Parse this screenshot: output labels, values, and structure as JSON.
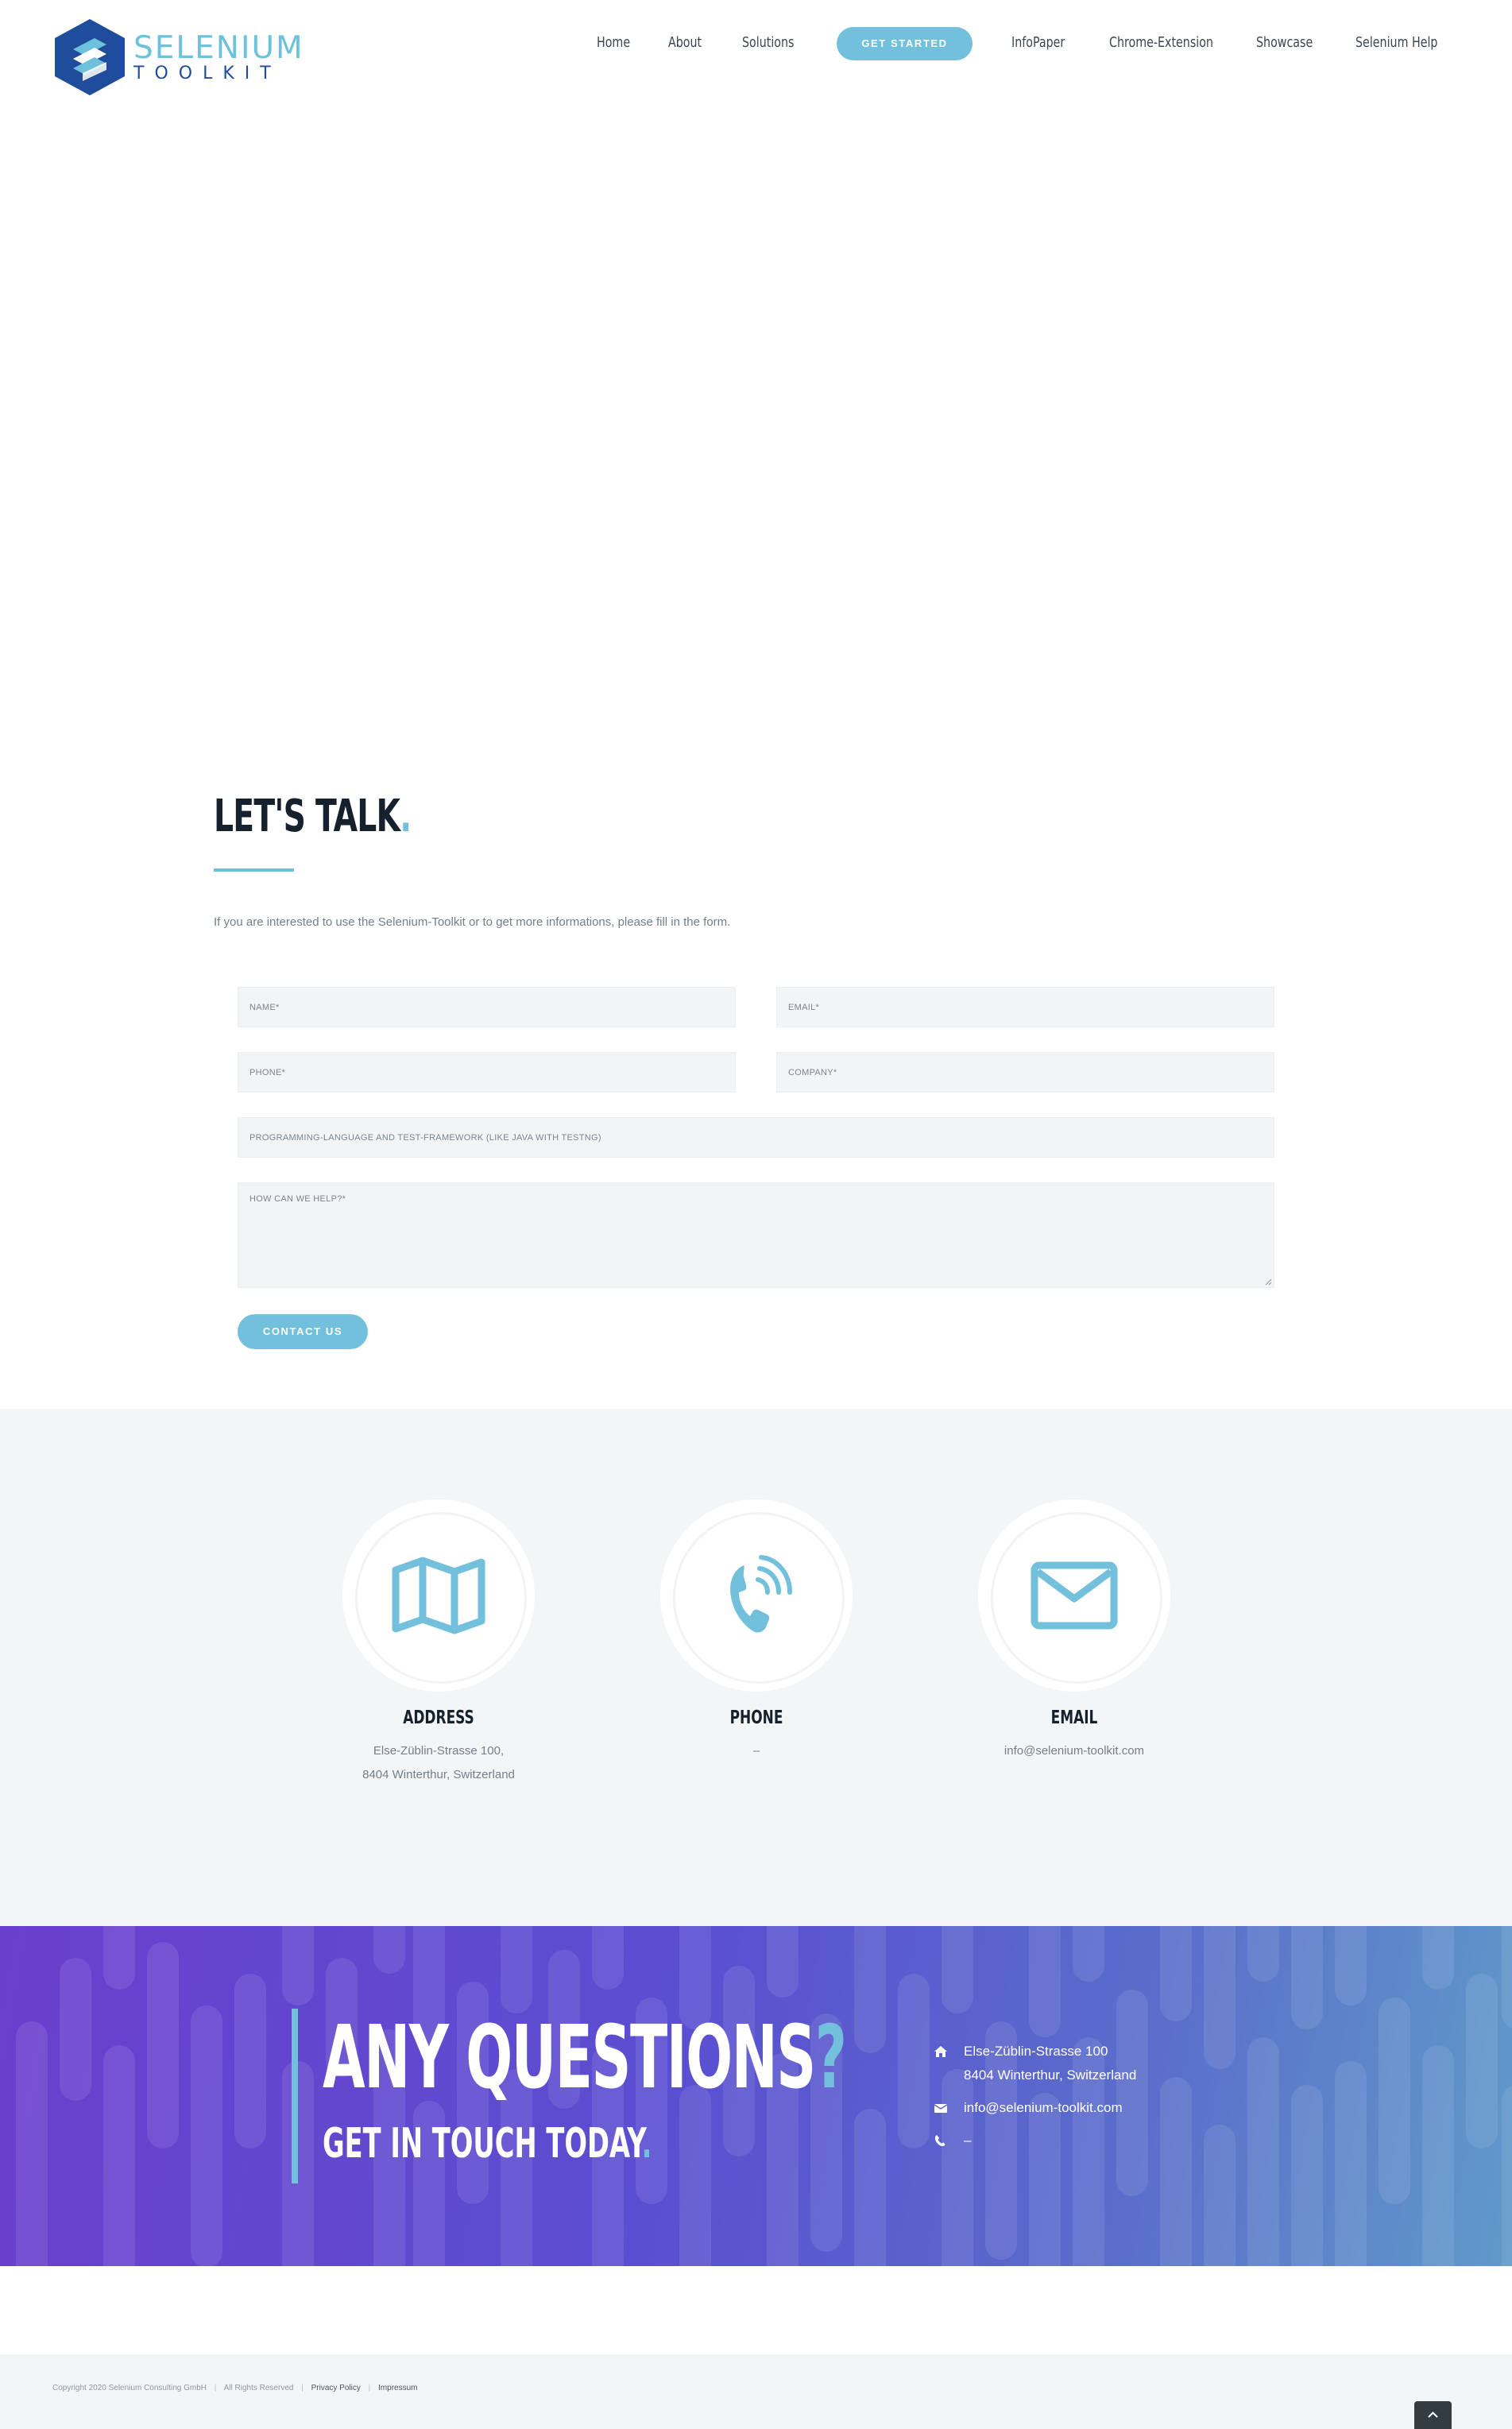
{
  "brand": {
    "word1": "SELENIUM",
    "word2": "TOOLKIT",
    "colors": {
      "accent": "#72c0dc",
      "dark": "#15212d",
      "logo_blue": "#1f4c9b"
    }
  },
  "nav": {
    "items": [
      "Home",
      "About",
      "Solutions",
      "InfoPaper",
      "Chrome-Extension",
      "Showcase",
      "Selenium Help"
    ],
    "cta": "GET STARTED"
  },
  "contact": {
    "title": "LET'S TALK",
    "title_dot": ".",
    "intro": "If you are interested to use the Selenium-Toolkit or to get more informations, please fill in the form.",
    "fields": {
      "name": "NAME*",
      "email": "EMAIL*",
      "phone": "PHONE*",
      "company": "COMPANY*",
      "language": "PROGRAMMING-LANGUAGE AND TEST-FRAMEWORK (LIKE JAVA WITH TESTNG)",
      "help": "HOW CAN WE HELP?*"
    },
    "submit": "CONTACT US"
  },
  "info": {
    "address": {
      "heading": "ADDRESS",
      "line1": "Else-Züblin-Strasse 100,",
      "line2": "8404 Winterthur, Switzerland",
      "icon": "map-icon"
    },
    "phone": {
      "heading": "PHONE",
      "value": "–",
      "icon": "phone-icon"
    },
    "email": {
      "heading": "EMAIL",
      "value": "info@selenium-toolkit.com",
      "icon": "envelope-icon"
    }
  },
  "banner": {
    "title": "ANY QUESTIONS",
    "title_mark": "?",
    "subtitle": "GET IN TOUCH TODAY",
    "subtitle_dot": ".",
    "address_line1": "Else-Züblin-Strasse 100",
    "address_line2": "8404 Winterthur, Switzerland",
    "email": "info@selenium-toolkit.com",
    "phone": "–"
  },
  "footer": {
    "copyright": "Copyright 2020 Selenium Consulting GmbH",
    "rights": "All Rights Reserved",
    "privacy": "Privacy Policy",
    "impressum": "Impressum",
    "sep": "|"
  }
}
